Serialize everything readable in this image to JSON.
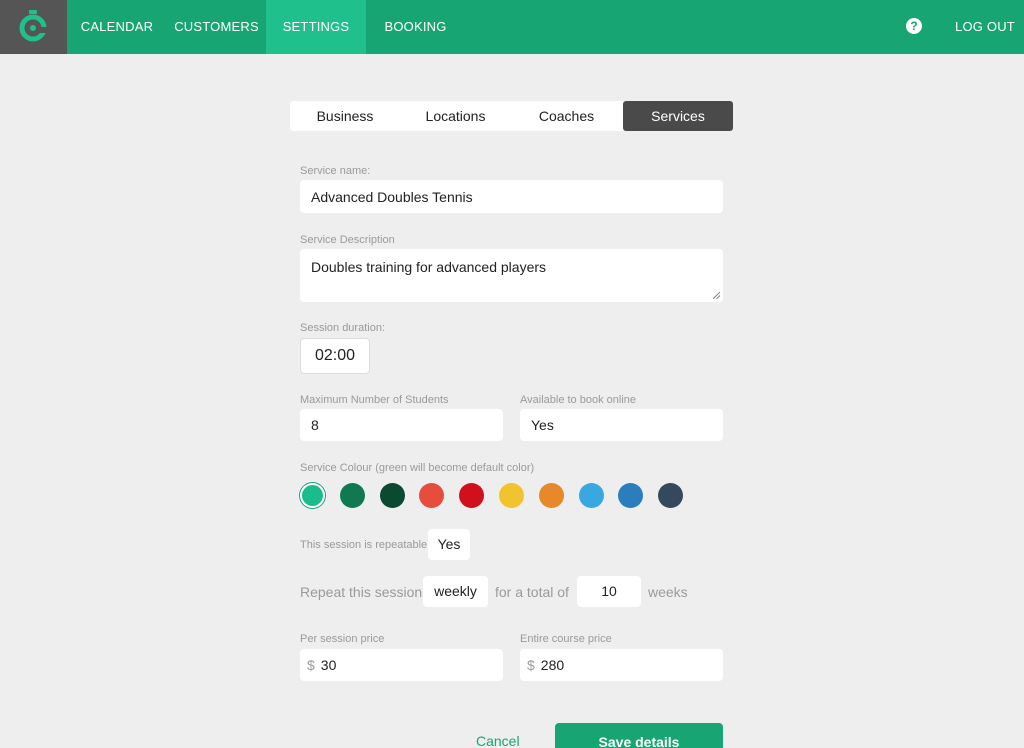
{
  "nav": {
    "logo_icon": "timer-logo-icon",
    "items": [
      {
        "label": "CALENDAR"
      },
      {
        "label": "CUSTOMERS"
      },
      {
        "label": "SETTINGS"
      },
      {
        "label": "BOOKING"
      }
    ],
    "active": "SETTINGS",
    "help_icon": "question-circle-icon",
    "logout": "LOG OUT"
  },
  "tabs": {
    "items": [
      {
        "label": "Business"
      },
      {
        "label": "Locations"
      },
      {
        "label": "Coaches"
      },
      {
        "label": "Services"
      }
    ],
    "active": "Services"
  },
  "form": {
    "service_name": {
      "label": "Service name:",
      "value": "Advanced Doubles Tennis"
    },
    "service_description": {
      "label": "Service Description",
      "value": "Doubles training for advanced players"
    },
    "session_duration": {
      "label": "Session duration:",
      "value": "02:00"
    },
    "max_students": {
      "label": "Maximum Number of Students",
      "value": "8"
    },
    "available_online": {
      "label": "Available to book online",
      "value": "Yes"
    },
    "service_colour": {
      "label": "Service Colour (green will become default color)",
      "colors": [
        "#1abc8c",
        "#0f7a52",
        "#0a4a30",
        "#e84c3d",
        "#d0101a",
        "#f2c32d",
        "#e7882a",
        "#3aa6e2",
        "#2a7ebc",
        "#34495e"
      ],
      "selected_index": 0
    },
    "repeatable": {
      "label": "This session is repeatable",
      "value": "Yes"
    },
    "repeat": {
      "prefix": "Repeat this session",
      "frequency": "weekly",
      "middle": "for a total of",
      "count": "10",
      "suffix": "weeks"
    },
    "per_session_price": {
      "label": "Per session price",
      "currency": "$",
      "value": "30"
    },
    "course_price": {
      "label": "Entire course price",
      "currency": "$",
      "value": "280"
    }
  },
  "actions": {
    "cancel": "Cancel",
    "save": "Save details"
  }
}
